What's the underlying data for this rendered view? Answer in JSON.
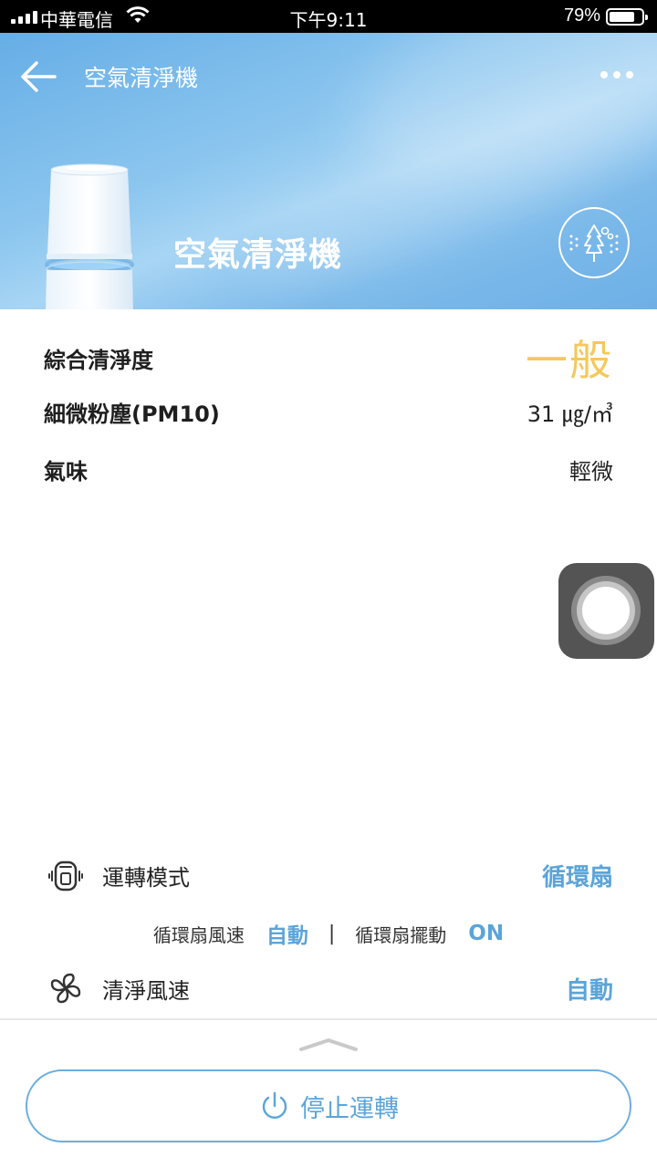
{
  "status_bar": {
    "carrier": "中華電信",
    "time": "下午9:11",
    "battery_percent": "79%",
    "battery_level": 0.79
  },
  "header": {
    "nav_title": "空氣清淨機",
    "device_name": "空氣清淨機",
    "back_icon": "arrow-left-icon",
    "more_icon": "more-horizontal-icon",
    "mode_icon": "tree-fresh-air-icon"
  },
  "air_quality": {
    "overall": {
      "label": "綜合清淨度",
      "value": "一般",
      "color": "#f5c85a"
    },
    "pm10": {
      "label": "細微粉塵(PM10)",
      "value": "31 ㎍/㎥"
    },
    "odor": {
      "label": "氣味",
      "value": "輕微"
    }
  },
  "controls": {
    "operation_mode": {
      "label": "運轉模式",
      "value": "循環扇",
      "icon": "purifier-mode-icon"
    },
    "circulator": {
      "speed_label": "循環扇風速",
      "speed_value": "自動",
      "divider": "|",
      "swing_label": "循環扇擺動",
      "swing_value": "ON"
    },
    "clean_speed": {
      "label": "清淨風速",
      "value": "自動",
      "icon": "fan-icon"
    }
  },
  "stop_button": {
    "label": "停止運轉",
    "icon": "power-icon"
  },
  "colors": {
    "accent": "#5ba4d8",
    "header_blue": "#6eb0e6",
    "overall_yellow": "#f5c85a"
  }
}
